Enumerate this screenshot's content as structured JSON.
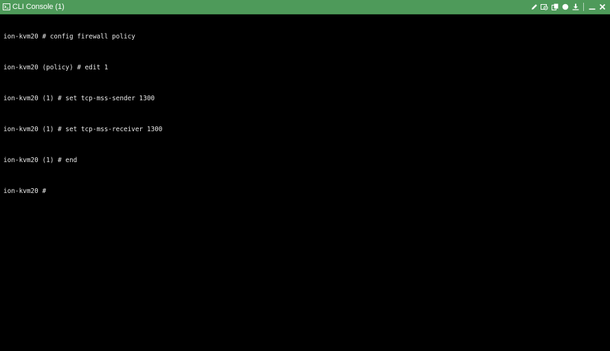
{
  "window": {
    "title": "CLI Console (1)",
    "titlebar_color": "#4e9a5a",
    "title_icon": "terminal-icon"
  },
  "toolbar": {
    "buttons": [
      {
        "icon": "pencil-icon"
      },
      {
        "icon": "settings-screen-icon"
      },
      {
        "icon": "copy-icon"
      },
      {
        "icon": "record-icon"
      },
      {
        "icon": "download-icon"
      },
      {
        "icon": "minimize-icon"
      },
      {
        "icon": "close-icon"
      }
    ]
  },
  "terminal": {
    "background": "#000000",
    "lines": [
      "ion-kvm20 # config firewall policy",
      "ion-kvm20 (policy) # edit 1",
      "ion-kvm20 (1) # set tcp-mss-sender 1300",
      "ion-kvm20 (1) # set tcp-mss-receiver 1300",
      "ion-kvm20 (1) # end",
      "ion-kvm20 # "
    ]
  }
}
